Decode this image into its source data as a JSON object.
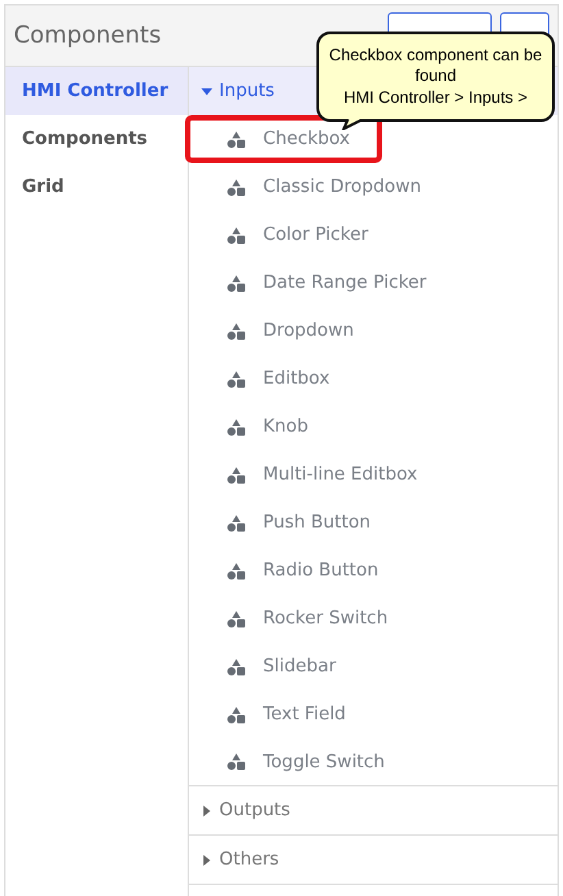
{
  "header": {
    "title": "Components"
  },
  "sidebar": {
    "items": [
      {
        "label": "HMI Controller",
        "selected": true
      },
      {
        "label": "Components",
        "selected": false
      },
      {
        "label": "Grid",
        "selected": false
      }
    ]
  },
  "groups": [
    {
      "label": "Inputs",
      "expanded": true,
      "items": [
        {
          "label": "Checkbox",
          "highlighted": true
        },
        {
          "label": "Classic Dropdown",
          "highlighted": false
        },
        {
          "label": "Color Picker",
          "highlighted": false
        },
        {
          "label": "Date Range Picker",
          "highlighted": false
        },
        {
          "label": "Dropdown",
          "highlighted": false
        },
        {
          "label": "Editbox",
          "highlighted": false
        },
        {
          "label": "Knob",
          "highlighted": false
        },
        {
          "label": "Multi-line Editbox",
          "highlighted": false
        },
        {
          "label": "Push Button",
          "highlighted": false
        },
        {
          "label": "Radio Button",
          "highlighted": false
        },
        {
          "label": "Rocker Switch",
          "highlighted": false
        },
        {
          "label": "Slidebar",
          "highlighted": false
        },
        {
          "label": "Text Field",
          "highlighted": false
        },
        {
          "label": "Toggle Switch",
          "highlighted": false
        }
      ]
    },
    {
      "label": "Outputs",
      "expanded": false
    },
    {
      "label": "Others",
      "expanded": false
    }
  ],
  "callout": {
    "text": "Checkbox component can be\nfound\nHMI Controller > Inputs >"
  }
}
